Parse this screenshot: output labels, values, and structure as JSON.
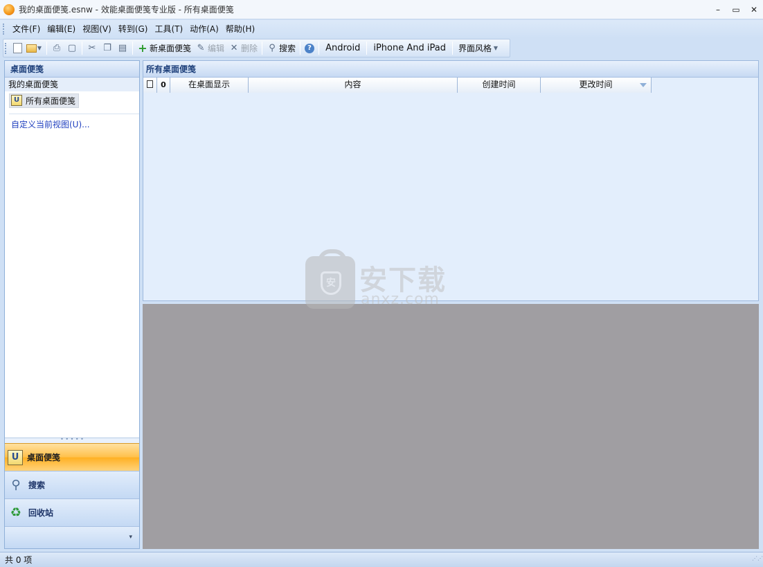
{
  "window": {
    "title": "我的桌面便笺.esnw - 效能桌面便笺专业版 - 所有桌面便笺",
    "minimize": "–",
    "maximize": "▭",
    "close": "✕"
  },
  "menu": {
    "items": [
      "文件(F)",
      "编辑(E)",
      "视图(V)",
      "转到(G)",
      "工具(T)",
      "动作(A)",
      "帮助(H)"
    ]
  },
  "toolbar": {
    "new_note": "新桌面便笺",
    "edit": "编辑",
    "delete": "删除",
    "search": "搜索",
    "android": "Android",
    "iphone": "iPhone And iPad",
    "skin": "界面风格"
  },
  "left_panel": {
    "header": "桌面便笺",
    "section": "我的桌面便笺",
    "all_notes": "所有桌面便笺",
    "customize": "自定义当前视图(U)..."
  },
  "nav_buttons": {
    "notes": "桌面便笺",
    "search": "搜索",
    "recycle": "回收站"
  },
  "main": {
    "header": "所有桌面便笺",
    "columns": [
      "",
      "",
      "在桌面显示",
      "内容",
      "创建时间",
      "更改时间"
    ]
  },
  "watermark": {
    "title": "安下载",
    "sub": "anxz.com",
    "badge": "安"
  },
  "status": {
    "count": "共 0 项"
  }
}
